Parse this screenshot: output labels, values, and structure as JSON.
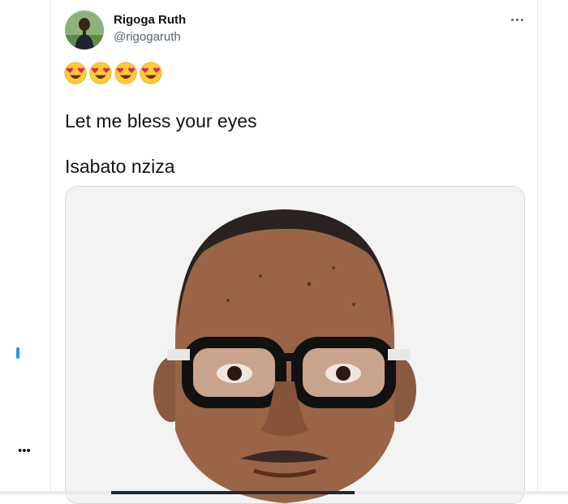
{
  "tweet": {
    "display_name": "Rigoga Ruth",
    "handle": "@rigogaruth",
    "emojis": [
      "smiling-face-heart-eyes",
      "smiling-face-heart-eyes",
      "smiling-face-heart-eyes",
      "smiling-face-heart-eyes"
    ],
    "text_line1": "Let me bless your eyes",
    "text_line2": "Isabato nziza"
  },
  "colors": {
    "border": "#e6ecf0",
    "text_primary": "#0f1419",
    "text_secondary": "#536471",
    "accent": "#1d9bf0"
  },
  "icons": {
    "more": "more-horizontal-icon",
    "emoji": "heart-eyes-emoji-icon"
  }
}
